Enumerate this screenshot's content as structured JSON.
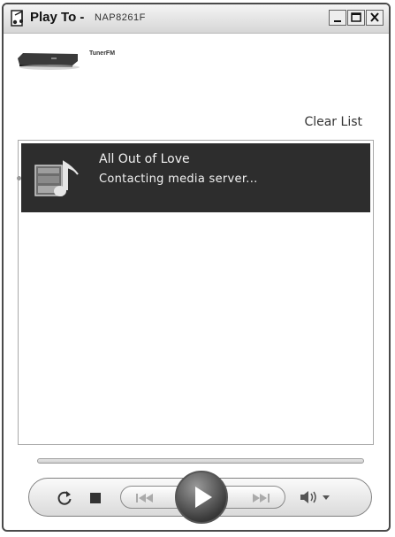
{
  "window": {
    "title": "Play To -",
    "device_label": "NAP8261F"
  },
  "device": {
    "name": "TunerFM"
  },
  "toolbar": {
    "clear_list_label": "Clear List"
  },
  "playlist": [
    {
      "title": "All Out of Love",
      "status": "Contacting media server..."
    }
  ],
  "controls": {
    "icons": [
      "repeat-icon",
      "stop-icon",
      "previous-icon",
      "play-icon",
      "next-icon",
      "volume-icon",
      "chevron-down-icon"
    ]
  },
  "colors": {
    "selected_row_bg": "#2d2d2d",
    "selected_row_text": "#f2f2f2"
  }
}
